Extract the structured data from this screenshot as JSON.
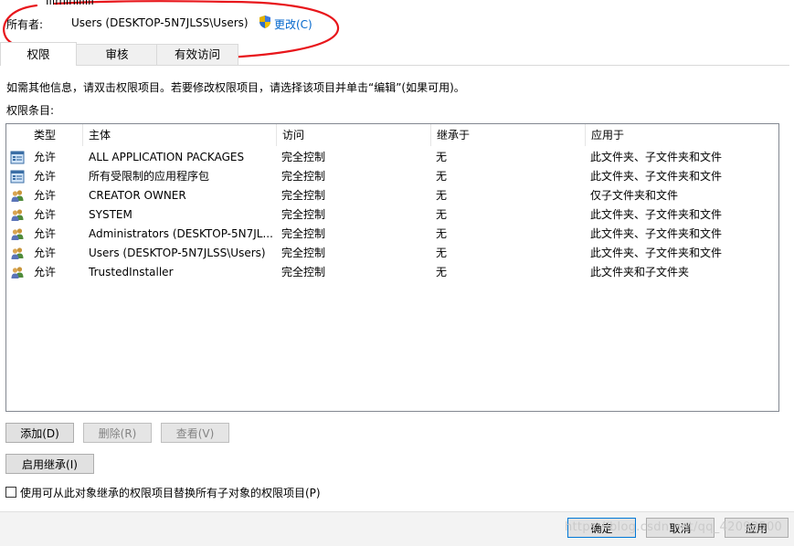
{
  "owner": {
    "label": "所有者:",
    "value": "Users (DESKTOP-5N7JLSS\\Users)",
    "change_link": "更改(C)"
  },
  "tabs": [
    {
      "label": "权限",
      "active": true
    },
    {
      "label": "审核",
      "active": false
    },
    {
      "label": "有效访问",
      "active": false
    }
  ],
  "instruction": "如需其他信息，请双击权限项目。若要修改权限项目，请选择该项目并单击“编辑”(如果可用)。",
  "entries_label": "权限条目:",
  "table": {
    "columns": [
      "类型",
      "主体",
      "访问",
      "继承于",
      "应用于"
    ],
    "rows": [
      {
        "icon": "package-icon",
        "type": "允许",
        "principal": "ALL APPLICATION PACKAGES",
        "access": "完全控制",
        "inherited": "无",
        "applies": "此文件夹、子文件夹和文件"
      },
      {
        "icon": "package-icon",
        "type": "允许",
        "principal": "所有受限制的应用程序包",
        "access": "完全控制",
        "inherited": "无",
        "applies": "此文件夹、子文件夹和文件"
      },
      {
        "icon": "users-icon",
        "type": "允许",
        "principal": "CREATOR OWNER",
        "access": "完全控制",
        "inherited": "无",
        "applies": "仅子文件夹和文件"
      },
      {
        "icon": "users-icon",
        "type": "允许",
        "principal": "SYSTEM",
        "access": "完全控制",
        "inherited": "无",
        "applies": "此文件夹、子文件夹和文件"
      },
      {
        "icon": "users-icon",
        "type": "允许",
        "principal": "Administrators (DESKTOP-5N7JL...",
        "access": "完全控制",
        "inherited": "无",
        "applies": "此文件夹、子文件夹和文件"
      },
      {
        "icon": "users-icon",
        "type": "允许",
        "principal": "Users (DESKTOP-5N7JLSS\\Users)",
        "access": "完全控制",
        "inherited": "无",
        "applies": "此文件夹、子文件夹和文件"
      },
      {
        "icon": "users-icon",
        "type": "允许",
        "principal": "TrustedInstaller",
        "access": "完全控制",
        "inherited": "无",
        "applies": "此文件夹和子文件夹"
      }
    ]
  },
  "buttons": {
    "add": "添加(D)",
    "remove": "删除(R)",
    "view": "查看(V)",
    "enable_inheritance": "启用继承(I)",
    "ok": "确定",
    "cancel": "取消",
    "apply": "应用"
  },
  "replace_checkbox": {
    "label": "使用可从此对象继承的权限项目替换所有子对象的权限项目(P)",
    "checked": false
  },
  "watermark": "https://blog.csdn.net/qq_42093500",
  "colors": {
    "annotation_red": "#e8161b",
    "link_blue": "#0066cc",
    "focus_blue": "#0078d7"
  }
}
